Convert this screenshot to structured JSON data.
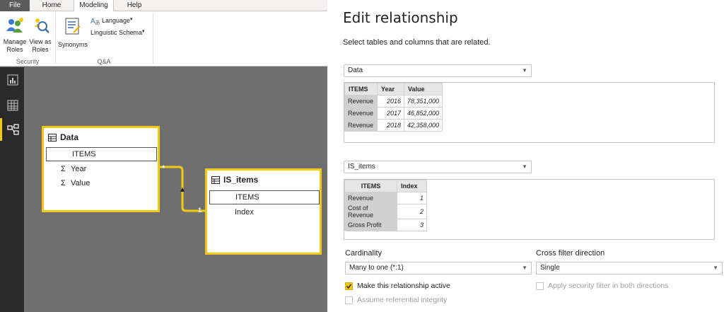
{
  "tabs": [
    "File",
    "Home",
    "Modeling",
    "Help"
  ],
  "ribbon": {
    "manage_roles": [
      "Manage",
      "Roles"
    ],
    "view_as_roles": [
      "View as",
      "Roles"
    ],
    "synonyms": "Synonyms",
    "language": "Language",
    "linguistic_schema": "Linguistic Schema",
    "group_security": "Security",
    "group_qa": "Q&A"
  },
  "diagram": {
    "data_table": {
      "title": "Data",
      "fields": [
        "ITEMS",
        "Year",
        "Value"
      ]
    },
    "is_items_table": {
      "title": "IS_items",
      "fields": [
        "ITEMS",
        "Index"
      ]
    },
    "rel_many": "*",
    "rel_one": "1"
  },
  "dialog": {
    "title": "Edit relationship",
    "subtitle": "Select tables and columns that are related.",
    "table1": {
      "selected": "Data",
      "headers": [
        "ITEMS",
        "Year",
        "Value"
      ],
      "rows": [
        [
          "Revenue",
          "2016",
          "78,351,000"
        ],
        [
          "Revenue",
          "2017",
          "46,852,000"
        ],
        [
          "Revenue",
          "2018",
          "42,358,000"
        ]
      ]
    },
    "table2": {
      "selected": "IS_items",
      "headers": [
        "ITEMS",
        "Index"
      ],
      "rows": [
        [
          "Revenue",
          "1"
        ],
        [
          "Cost of Revenue",
          "2"
        ],
        [
          "Gross Profit",
          "3"
        ]
      ]
    },
    "cardinality_label": "Cardinality",
    "cardinality_value": "Many to one (*:1)",
    "cross_filter_label": "Cross filter direction",
    "cross_filter_value": "Single",
    "make_active": "Make this relationship active",
    "make_active_checked": true,
    "apply_security": "Apply security filter in both directions",
    "assume_integrity": "Assume referential integrity"
  },
  "colors": {
    "accent": "#f2c811",
    "canvas": "#6f6f6f",
    "rail": "#2b2b2b"
  },
  "icons": [
    "manage-roles-icon",
    "view-as-roles-icon",
    "synonyms-icon",
    "language-icon",
    "report-view-icon",
    "data-view-icon",
    "model-view-icon",
    "table-icon",
    "sigma-icon",
    "chevron-down-icon",
    "checkbox-icon"
  ]
}
